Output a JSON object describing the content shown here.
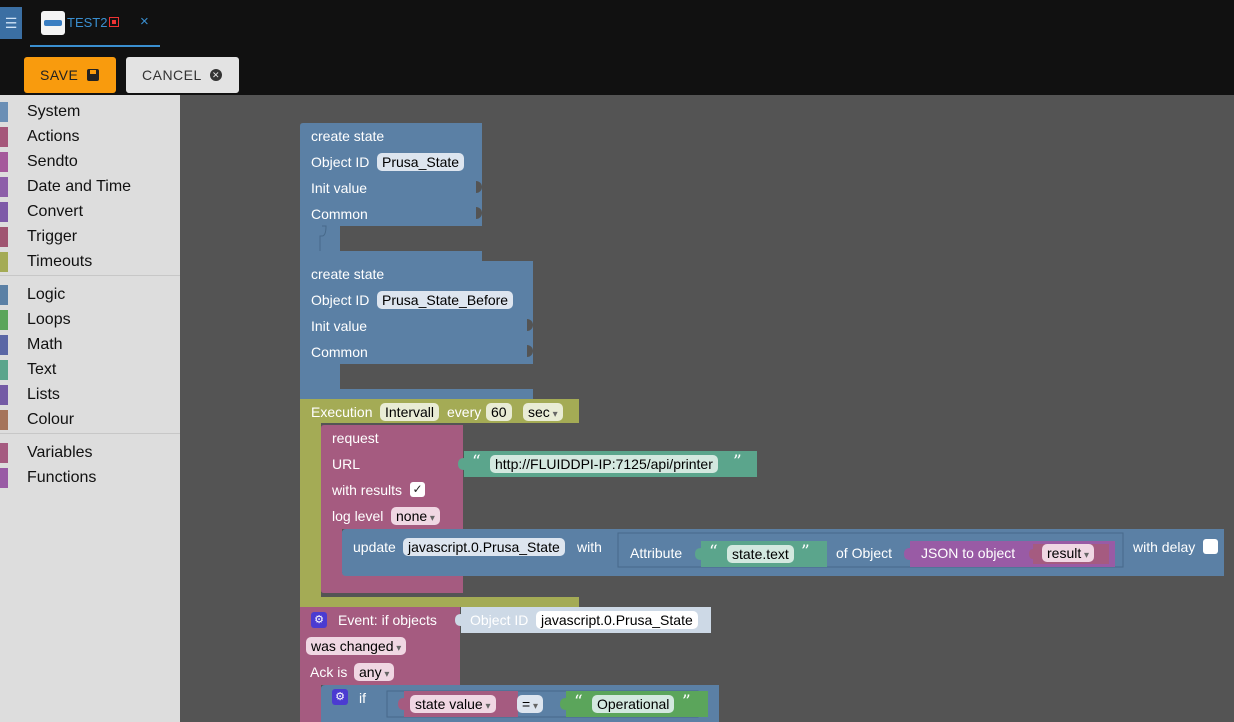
{
  "tabs": [
    {
      "label": "TEST2",
      "close_label": "×"
    }
  ],
  "toolbar": {
    "save_label": "SAVE",
    "cancel_label": "CANCEL"
  },
  "sidebar": {
    "groups": [
      {
        "items": [
          {
            "label": "System",
            "color": "#6b8fb5"
          },
          {
            "label": "Actions",
            "color": "#a5577a"
          },
          {
            "label": "Sendto",
            "color": "#a5599b"
          },
          {
            "label": "Date and Time",
            "color": "#8d5fa9"
          },
          {
            "label": "Convert",
            "color": "#7e5aa8"
          },
          {
            "label": "Trigger",
            "color": "#a05571"
          },
          {
            "label": "Timeouts",
            "color": "#a4ab55"
          }
        ]
      },
      {
        "items": [
          {
            "label": "Logic",
            "color": "#5b80a5"
          },
          {
            "label": "Loops",
            "color": "#5ba55b"
          },
          {
            "label": "Math",
            "color": "#5b67a5"
          },
          {
            "label": "Text",
            "color": "#5ba58c"
          },
          {
            "label": "Lists",
            "color": "#745ba5"
          },
          {
            "label": "Colour",
            "color": "#a5745b"
          }
        ]
      },
      {
        "items": [
          {
            "label": "Variables",
            "color": "#a55b80"
          },
          {
            "label": "Functions",
            "color": "#995ba5"
          }
        ]
      }
    ]
  },
  "blocks": {
    "create_state_1": {
      "title": "create state",
      "object_id_label": "Object ID",
      "object_id": "Prusa_State",
      "init_label": "Init value",
      "common_label": "Common"
    },
    "create_state_2": {
      "title": "create state",
      "object_id_label": "Object ID",
      "object_id": "Prusa_State_Before",
      "init_label": "Init value",
      "common_label": "Common"
    },
    "schedule": {
      "title": "Execution",
      "mode": "Intervall",
      "every_label": "every",
      "interval": "60",
      "unit": "sec"
    },
    "request": {
      "title": "request",
      "url_label": "URL",
      "url": "http://FLUIDDPI-IP:7125/api/printer",
      "with_results_label": "with results",
      "with_results_checked": "✓",
      "log_level_label": "log level",
      "log_level": "none"
    },
    "update": {
      "label": "update",
      "target": "javascript.0.Prusa_State",
      "with_label": "with",
      "attribute_label": "Attribute",
      "attribute": "state.text",
      "of_object_label": "of Object",
      "json_label": "JSON to object",
      "result_var": "result",
      "delay_label": "with delay"
    },
    "event": {
      "title": "Event: if objects",
      "object_id_label": "Object ID",
      "object_id": "javascript.0.Prusa_State",
      "change": "was changed",
      "ack_label": "Ack is",
      "ack": "any"
    },
    "if_block": {
      "label": "if",
      "left": "state value",
      "operator": "=",
      "right": "Operational"
    }
  },
  "colors": {
    "blue_block": "#5b80a5",
    "olive_block": "#a4ab55",
    "pink_block": "#a55b80",
    "purple_block": "#995ba5",
    "mint_block": "#5ba58c",
    "save_button": "#f99b0d"
  }
}
